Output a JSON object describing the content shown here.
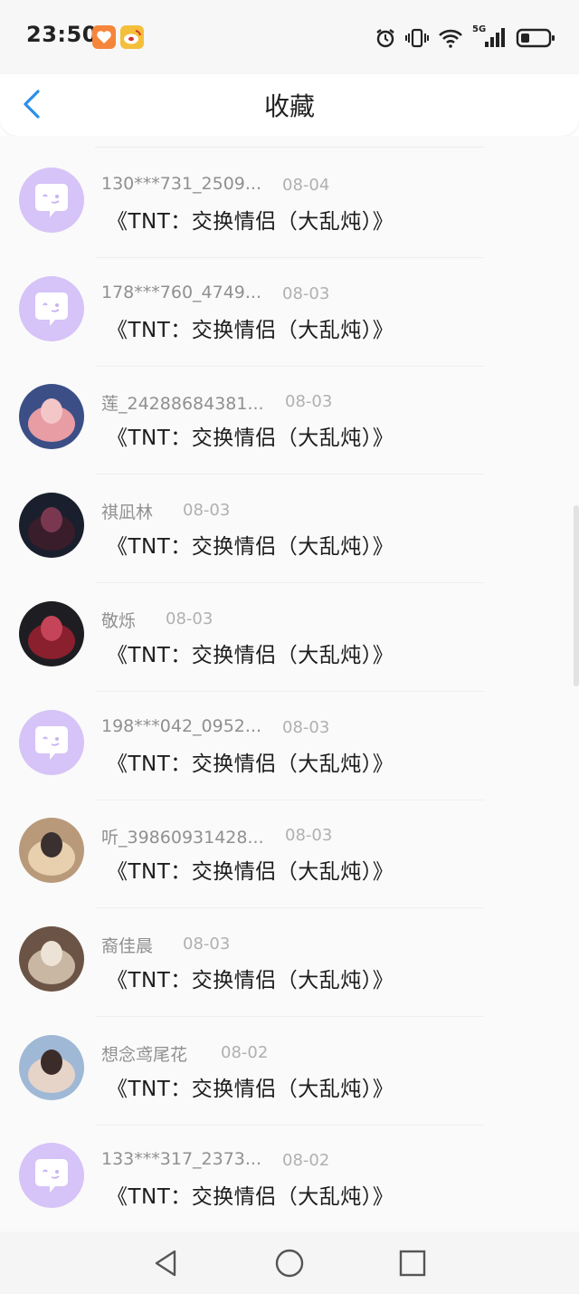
{
  "status_bar": {
    "time": "23:50",
    "network": "5G",
    "icons": [
      "alarm-icon",
      "vibrate-icon",
      "wifi-icon",
      "signal-icon",
      "battery-icon"
    ],
    "app_badges": [
      "orange-app-icon",
      "weibo-icon"
    ]
  },
  "header": {
    "title": "收藏",
    "back_icon": "chevron-left-icon"
  },
  "colors": {
    "accent": "#2b8fe8",
    "default_avatar": "#d6c3f7",
    "text_primary": "#1d1d1d",
    "text_secondary": "#909090"
  },
  "items": [
    {
      "user": "130***731_2509...",
      "date": "08-04",
      "title": "《TNT：交换情侣（大乱炖）》",
      "avatar": "default-avatar"
    },
    {
      "user": "178***760_4749...",
      "date": "08-03",
      "title": "《TNT：交换情侣（大乱炖）》",
      "avatar": "default-avatar"
    },
    {
      "user": "莲_24288684381...",
      "date": "08-03",
      "title": "《TNT：交换情侣（大乱炖）》",
      "avatar": "lotus-photo"
    },
    {
      "user": "祺凪林",
      "date": "08-03",
      "title": "《TNT：交换情侣（大乱炖）》",
      "avatar": "photo-dark"
    },
    {
      "user": "敬烁",
      "date": "08-03",
      "title": "《TNT：交换情侣（大乱炖）》",
      "avatar": "photo-red"
    },
    {
      "user": "198***042_0952...",
      "date": "08-03",
      "title": "《TNT：交换情侣（大乱炖）》",
      "avatar": "default-avatar"
    },
    {
      "user": "听_39860931428...",
      "date": "08-03",
      "title": "《TNT：交换情侣（大乱炖）》",
      "avatar": "photo-sunset"
    },
    {
      "user": "裔佳晨",
      "date": "08-03",
      "title": "《TNT：交换情侣（大乱炖）》",
      "avatar": "photo-room"
    },
    {
      "user": "想念鸢尾花",
      "date": "08-02",
      "title": "《TNT：交换情侣（大乱炖）》",
      "avatar": "photo-portrait"
    },
    {
      "user": "133***317_2373...",
      "date": "08-02",
      "title": "《TNT：交换情侣（大乱炖）》",
      "avatar": "default-avatar"
    }
  ],
  "nav_bar": {
    "buttons": [
      "back-triangle-icon",
      "home-circle-icon",
      "recents-square-icon"
    ]
  }
}
